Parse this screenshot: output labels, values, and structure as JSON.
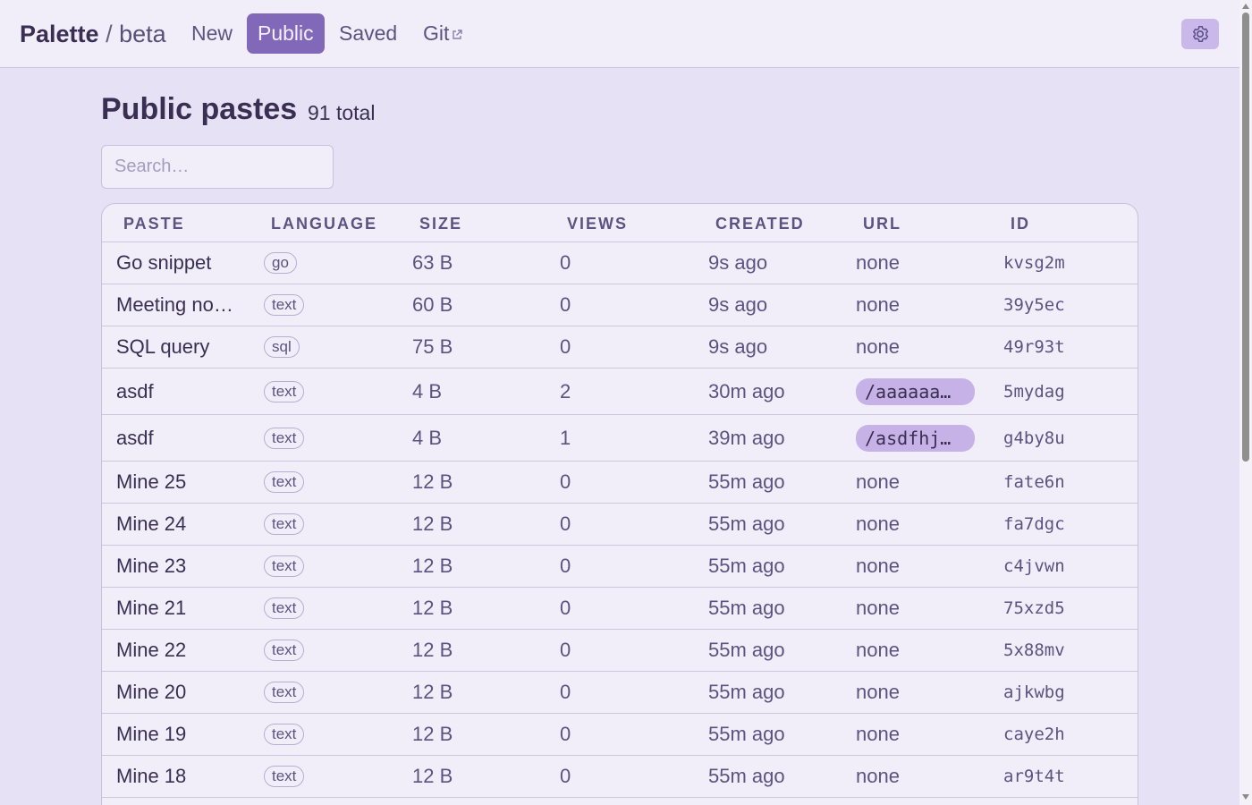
{
  "brand": {
    "name": "Palette",
    "separator": "/",
    "version": "beta"
  },
  "nav": [
    {
      "label": "New",
      "active": false
    },
    {
      "label": "Public",
      "active": true
    },
    {
      "label": "Saved",
      "active": false
    },
    {
      "label": "Git",
      "active": false,
      "external": true
    }
  ],
  "icons": {
    "settings": "gear-icon",
    "external": "external-link-icon"
  },
  "colors": {
    "accent": "#8268b8",
    "background": "#e6e1f4",
    "pill": "#c6b2e6"
  },
  "page": {
    "title": "Public pastes",
    "count": "91 total"
  },
  "search": {
    "placeholder": "Search…",
    "value": ""
  },
  "table": {
    "headers": [
      "PASTE",
      "LANGUAGE",
      "SIZE",
      "VIEWS",
      "CREATED",
      "URL",
      "ID"
    ],
    "rows": [
      {
        "name": "Go snippet",
        "lang": "go",
        "size": "63 B",
        "views": "0",
        "created": "9s ago",
        "url": "none",
        "url_is_link": false,
        "id": "kvsg2m"
      },
      {
        "name": "Meeting no…",
        "lang": "text",
        "size": "60 B",
        "views": "0",
        "created": "9s ago",
        "url": "none",
        "url_is_link": false,
        "id": "39y5ec"
      },
      {
        "name": "SQL query",
        "lang": "sql",
        "size": "75 B",
        "views": "0",
        "created": "9s ago",
        "url": "none",
        "url_is_link": false,
        "id": "49r93t"
      },
      {
        "name": "asdf",
        "lang": "text",
        "size": "4 B",
        "views": "2",
        "created": "30m ago",
        "url": "/aaaaaa…",
        "url_is_link": true,
        "id": "5mydag"
      },
      {
        "name": "asdf",
        "lang": "text",
        "size": "4 B",
        "views": "1",
        "created": "39m ago",
        "url": "/asdfhj…",
        "url_is_link": true,
        "id": "g4by8u"
      },
      {
        "name": "Mine 25",
        "lang": "text",
        "size": "12 B",
        "views": "0",
        "created": "55m ago",
        "url": "none",
        "url_is_link": false,
        "id": "fate6n"
      },
      {
        "name": "Mine 24",
        "lang": "text",
        "size": "12 B",
        "views": "0",
        "created": "55m ago",
        "url": "none",
        "url_is_link": false,
        "id": "fa7dgc"
      },
      {
        "name": "Mine 23",
        "lang": "text",
        "size": "12 B",
        "views": "0",
        "created": "55m ago",
        "url": "none",
        "url_is_link": false,
        "id": "c4jvwn"
      },
      {
        "name": "Mine 21",
        "lang": "text",
        "size": "12 B",
        "views": "0",
        "created": "55m ago",
        "url": "none",
        "url_is_link": false,
        "id": "75xzd5"
      },
      {
        "name": "Mine 22",
        "lang": "text",
        "size": "12 B",
        "views": "0",
        "created": "55m ago",
        "url": "none",
        "url_is_link": false,
        "id": "5x88mv"
      },
      {
        "name": "Mine 20",
        "lang": "text",
        "size": "12 B",
        "views": "0",
        "created": "55m ago",
        "url": "none",
        "url_is_link": false,
        "id": "ajkwbg"
      },
      {
        "name": "Mine 19",
        "lang": "text",
        "size": "12 B",
        "views": "0",
        "created": "55m ago",
        "url": "none",
        "url_is_link": false,
        "id": "caye2h"
      },
      {
        "name": "Mine 18",
        "lang": "text",
        "size": "12 B",
        "views": "0",
        "created": "55m ago",
        "url": "none",
        "url_is_link": false,
        "id": "ar9t4t"
      }
    ]
  }
}
